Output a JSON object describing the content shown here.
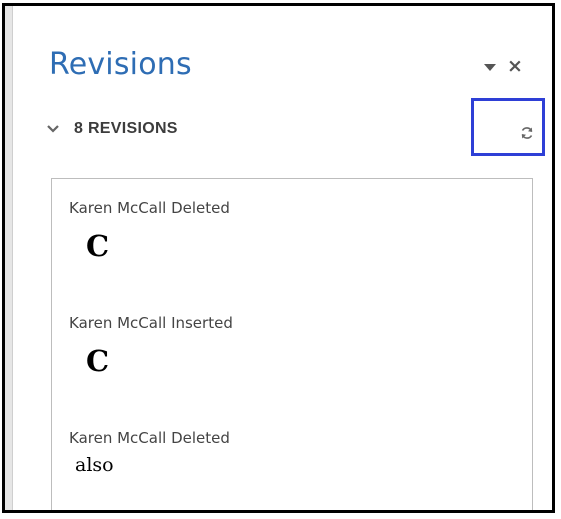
{
  "pane": {
    "title": "Revisions",
    "menu_icon": "dropdown-triangle-icon",
    "close_label": "×"
  },
  "summary": {
    "label": "8 REVISIONS",
    "chevron_icon": "chevron-down-icon",
    "refresh_icon": "refresh-icon"
  },
  "revisions": [
    {
      "author_action": "Karen McCall Deleted",
      "content": "C"
    },
    {
      "author_action": "Karen McCall Inserted",
      "content": "C"
    },
    {
      "author_action": "Karen McCall Deleted",
      "content": "also"
    }
  ],
  "colors": {
    "title": "#2e6db4",
    "highlight_border": "#2e3fd6"
  }
}
